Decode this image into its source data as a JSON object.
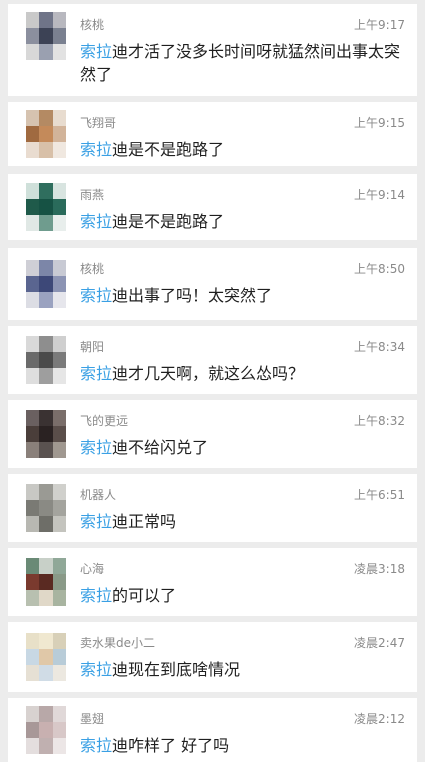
{
  "comments": [
    {
      "user": "核桃",
      "time": "上午9:17",
      "mention": "索拉",
      "text": "迪才活了没多长时间呀就猛然间出事太突然了",
      "avatar_colors": [
        "#c9c9c9",
        "#6f7488",
        "#b8b8bf",
        "#8b8f9e",
        "#3c4255",
        "#7a8090",
        "#d8d8d8",
        "#9aa0b0",
        "#e2e2e2"
      ]
    },
    {
      "user": "飞翔哥",
      "time": "上午9:15",
      "mention": "索拉",
      "text": "迪是不是跑路了",
      "avatar_colors": [
        "#d6c3b0",
        "#b48a63",
        "#e8dccf",
        "#a06a40",
        "#c48a5a",
        "#d2b49a",
        "#e9dcd0",
        "#d8c0a8",
        "#f0e8e0"
      ]
    },
    {
      "user": "雨燕",
      "time": "上午9:14",
      "mention": "索拉",
      "text": "迪是不是跑路了",
      "avatar_colors": [
        "#cfe0da",
        "#2f6e5e",
        "#d8e4e0",
        "#1f5a4a",
        "#165244",
        "#2a6b5b",
        "#e0e8e5",
        "#6f9c8e",
        "#e8eeec"
      ]
    },
    {
      "user": "核桃",
      "time": "上午8:50",
      "mention": "索拉",
      "text": "迪出事了吗！太突然了",
      "avatar_colors": [
        "#cfcfd6",
        "#7c86a8",
        "#c8cad4",
        "#5a6590",
        "#3d4878",
        "#8c94b4",
        "#dcdde4",
        "#9aa2c0",
        "#e6e6ec"
      ]
    },
    {
      "user": "朝阳",
      "time": "上午8:34",
      "mention": "索拉",
      "text": "迪才几天啊，就这么怂吗？",
      "avatar_colors": [
        "#d9d9d9",
        "#8e8e8e",
        "#cfcfcf",
        "#6a6a6a",
        "#4a4a4a",
        "#7a7a7a",
        "#dedede",
        "#9e9e9e",
        "#e6e6e6"
      ]
    },
    {
      "user": "飞的更远",
      "time": "上午8:32",
      "mention": "索拉",
      "text": "迪不给闪兑了",
      "avatar_colors": [
        "#6a6060",
        "#3a3232",
        "#7a6e6a",
        "#4a3e3a",
        "#2a2222",
        "#5a4e4a",
        "#8a807a",
        "#5a5250",
        "#a09890"
      ]
    },
    {
      "user": "机器人",
      "time": "上午6:51",
      "mention": "索拉",
      "text": "迪正常吗",
      "avatar_colors": [
        "#c8c8c4",
        "#9a9a94",
        "#d0d0cc",
        "#7a7a74",
        "#8a8a84",
        "#a4a49e",
        "#b8b8b2",
        "#6e6e68",
        "#c4c4be"
      ]
    },
    {
      "user": "心海",
      "time": "凌晨3:18",
      "mention": "索拉",
      "text": "的可以了",
      "avatar_colors": [
        "#6a8a76",
        "#c8d0c8",
        "#90a898",
        "#7a3a2e",
        "#5a2a22",
        "#8a9a88",
        "#b8c0b0",
        "#e0d8c8",
        "#a8b4a0"
      ]
    },
    {
      "user": "卖水果de小二",
      "time": "凌晨2:47",
      "mention": "索拉",
      "text": "迪现在到底啥情况",
      "avatar_colors": [
        "#e8e0c8",
        "#f0e8d0",
        "#d8d0b8",
        "#c8d8e4",
        "#e0c8a8",
        "#b8ccd8",
        "#e6e0d4",
        "#d0dce6",
        "#ece8e0"
      ]
    },
    {
      "user": "墨翅",
      "time": "凌晨2:12",
      "mention": "索拉",
      "text": "迪咋样了 好了吗",
      "avatar_colors": [
        "#d8d2d0",
        "#b8a8a8",
        "#e0d8d8",
        "#a89898",
        "#c8b0b0",
        "#d8c8c8",
        "#e4dede",
        "#c0b0b0",
        "#ece6e6"
      ]
    }
  ]
}
